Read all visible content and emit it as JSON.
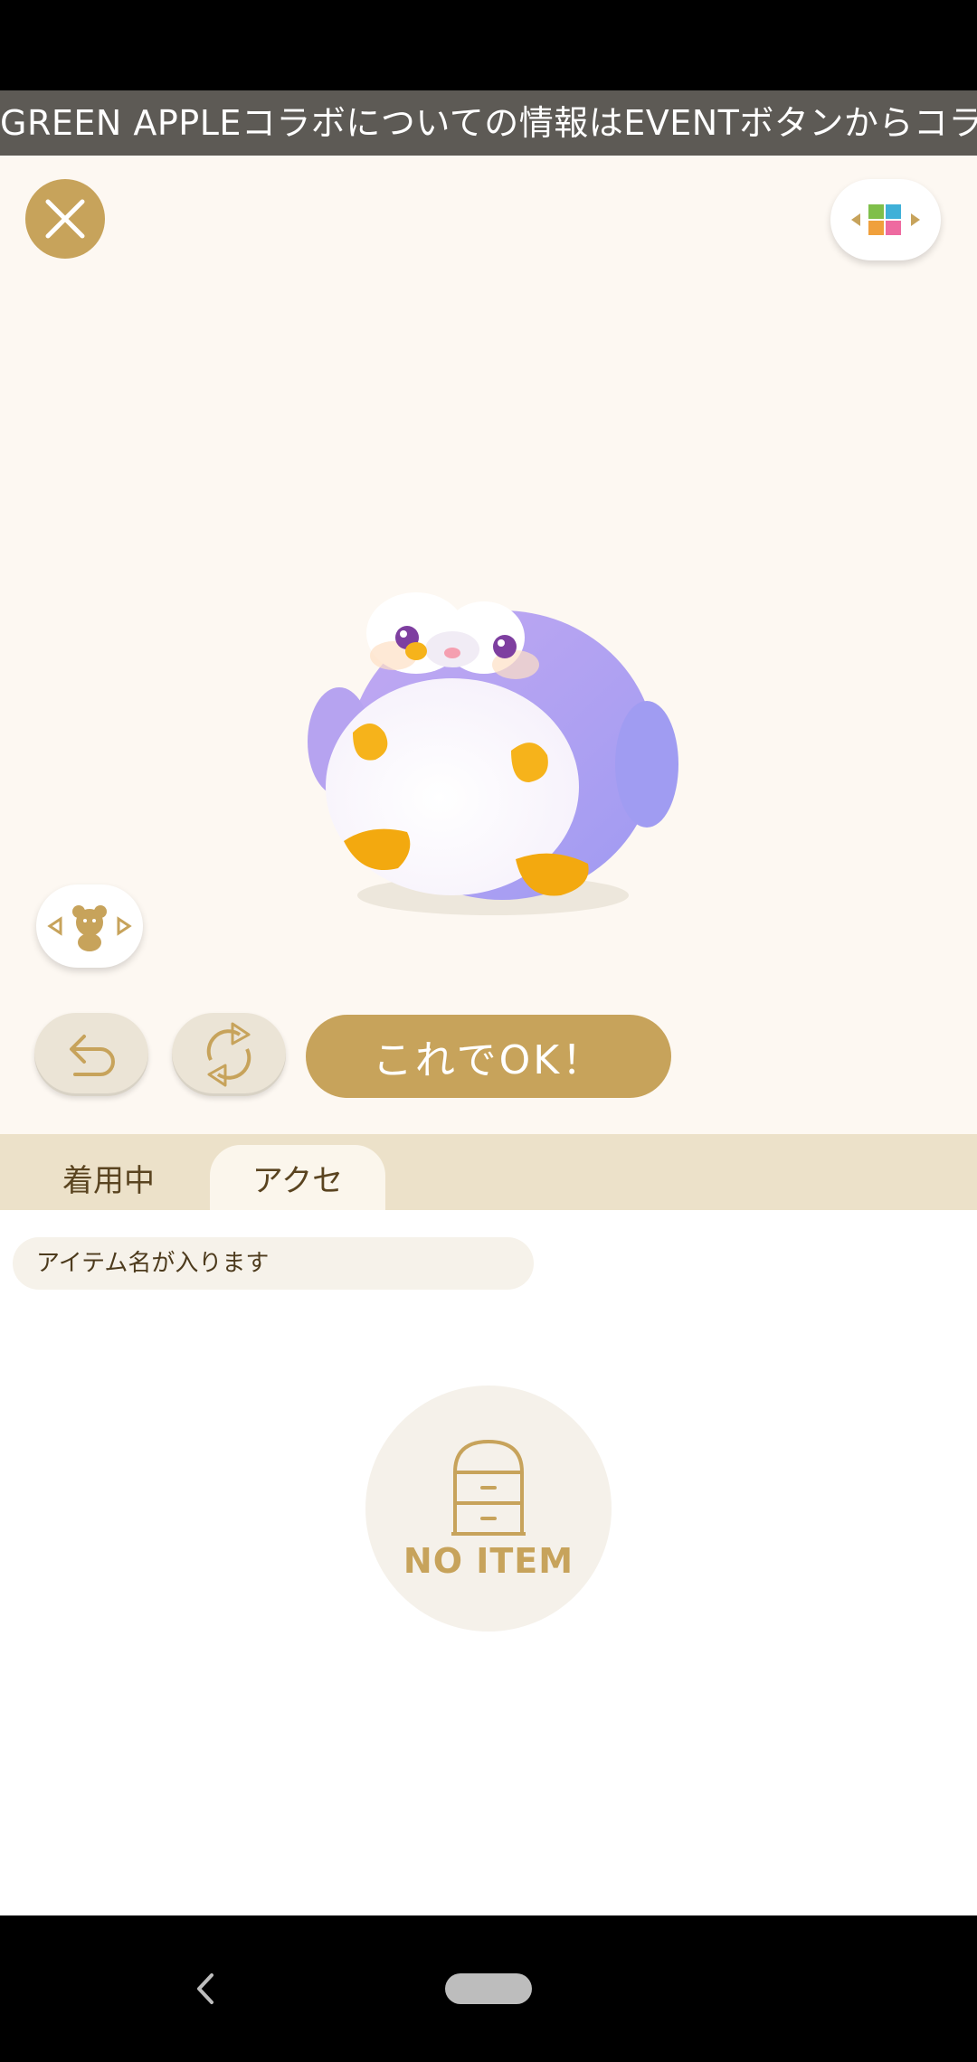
{
  "ticker": {
    "text": "GREEN APPLEコラボについての情報はEVENTボタンからコラボガイド"
  },
  "actions": {
    "confirm_label": "これでOK！"
  },
  "tabs": [
    {
      "label": "着用中"
    },
    {
      "label": "アクセ"
    }
  ],
  "item": {
    "name": "アイテム名が入ります"
  },
  "empty_state": {
    "label": "NO ITEM"
  },
  "icons": {
    "close": "close-icon",
    "background_switch": "palette-switch-icon",
    "character_switch": "bear-switch-icon",
    "undo": "undo-icon",
    "shuffle": "shuffle-icon",
    "empty": "drawer-icon"
  },
  "colors": {
    "accent_gold": "#c7a35b",
    "ticker_bg": "#5d5a55",
    "stage_bg": "#fdf8f2",
    "tab_bar_bg": "#ece1c9"
  }
}
